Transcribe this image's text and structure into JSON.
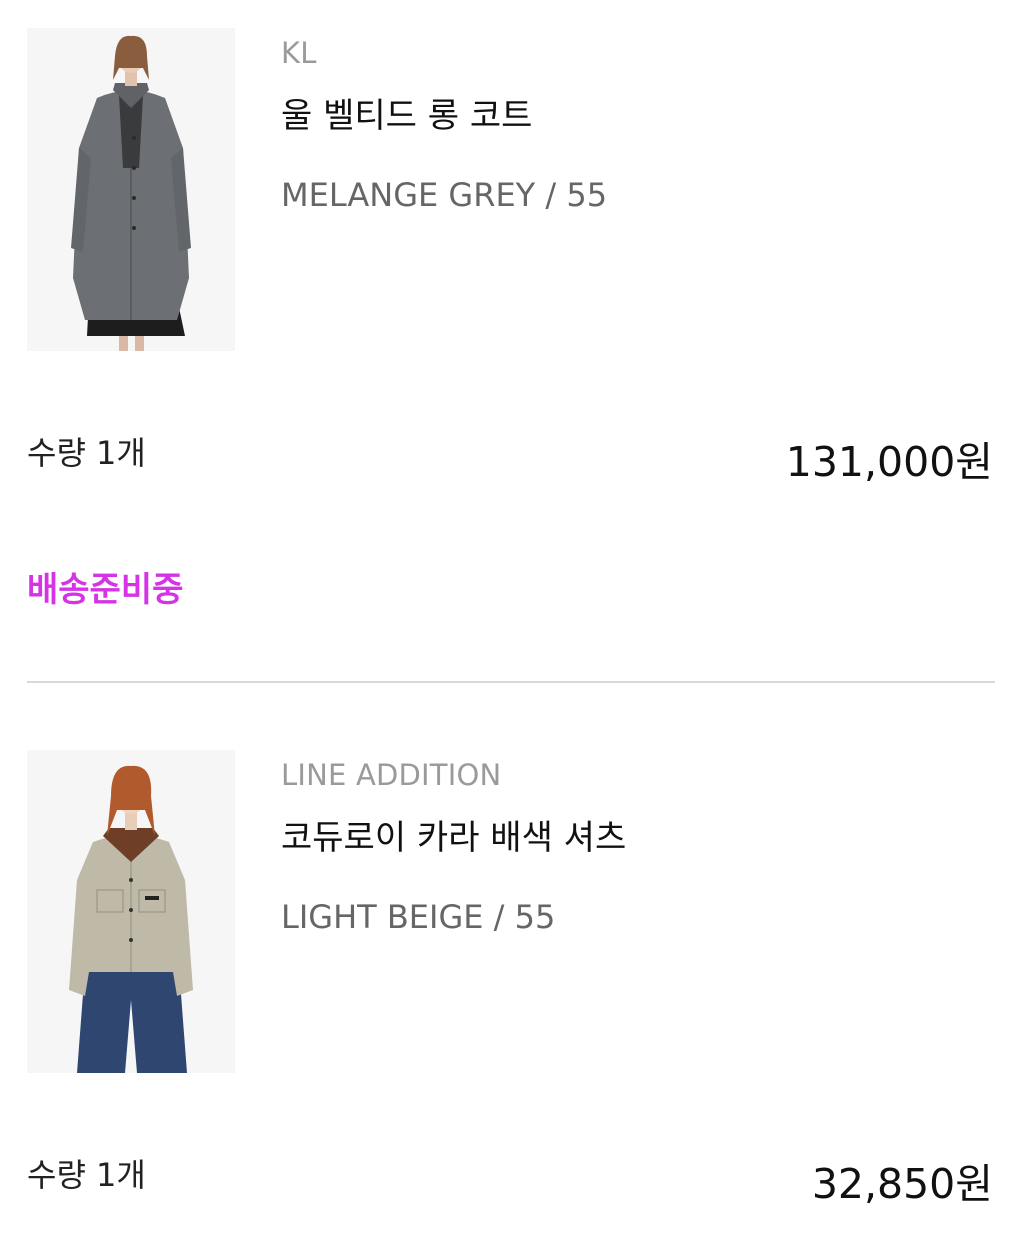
{
  "items": [
    {
      "brand": "KL",
      "name": "울 벨티드 롱 코트",
      "option": "MELANGE GREY / 55",
      "quantity": "수량 1개",
      "price": "131,000원",
      "status": "배송준비중",
      "image_alt": "gray-wool-long-coat-photo"
    },
    {
      "brand": "LINE ADDITION",
      "name": "코듀로이 카라 배색 셔츠",
      "option": "LIGHT BEIGE / 55",
      "quantity": "수량 1개",
      "price": "32,850원",
      "image_alt": "beige-shirt-jacket-photo"
    }
  ],
  "colors": {
    "status": "#d633e6",
    "divider": "#d9d9d9",
    "muted_text": "#9a9a9a",
    "option_text": "#666666"
  }
}
